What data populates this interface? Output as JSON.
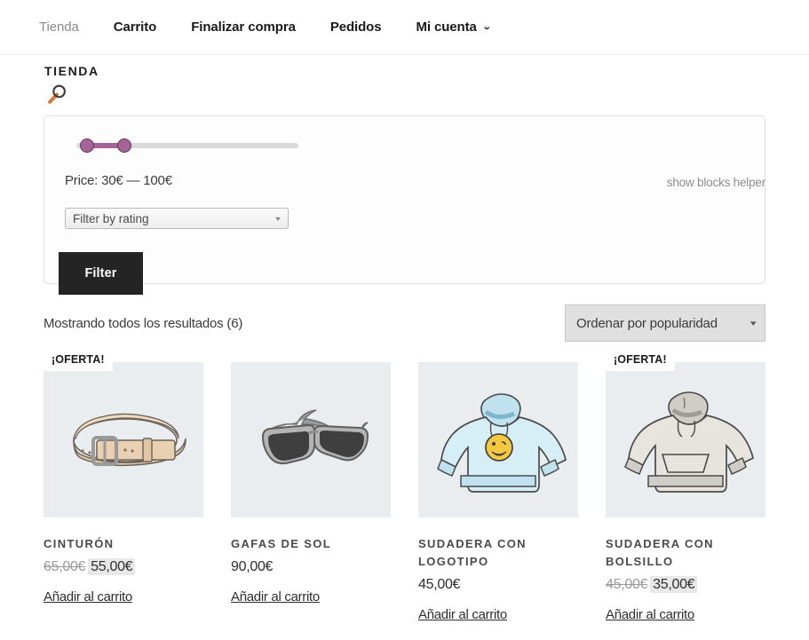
{
  "nav": {
    "items": [
      {
        "label": "Tienda",
        "muted": true,
        "caret": false
      },
      {
        "label": "Carrito",
        "muted": false,
        "caret": false
      },
      {
        "label": "Finalizar compra",
        "muted": false,
        "caret": false
      },
      {
        "label": "Pedidos",
        "muted": false,
        "caret": false
      },
      {
        "label": "Mi cuenta",
        "muted": false,
        "caret": true
      }
    ],
    "caret_glyph": "⌄"
  },
  "page": {
    "title": "TIENDA",
    "search_icon": "magnifier-icon",
    "blocks_helper": "show blocks helper"
  },
  "filter": {
    "price_label": "Price: 30€ — 100€",
    "price_min": "30€",
    "price_max": "100€",
    "slider_accent": "#a46497",
    "slider_track": "#dadada",
    "rating_placeholder": "Filter by rating",
    "caret_glyph": "▾",
    "button_label": "Filter",
    "button_color": "#242424"
  },
  "results": {
    "count_text": "Mostrando todos los resultados (6)",
    "sort_value": "Ordenar por popularidad",
    "caret_glyph": "▾"
  },
  "products": [
    {
      "name": "CINTURÓN",
      "on_sale": true,
      "sale_badge": "¡OFERTA!",
      "old_price": "65,00€",
      "price": "55,00€",
      "add_to_cart": "Añadir al carrito",
      "image": "belt-image"
    },
    {
      "name": "GAFAS DE SOL",
      "on_sale": false,
      "sale_badge": "",
      "old_price": "",
      "price": "90,00€",
      "add_to_cart": "Añadir al carrito",
      "image": "sunglasses-image"
    },
    {
      "name": "SUDADERA CON LOGOTIPO",
      "on_sale": false,
      "sale_badge": "",
      "old_price": "",
      "price": "45,00€",
      "add_to_cart": "Añadir al carrito",
      "image": "blue-hoodie-image"
    },
    {
      "name": "SUDADERA CON BOLSILLO",
      "on_sale": true,
      "sale_badge": "¡OFERTA!",
      "old_price": "45,00€",
      "price": "35,00€",
      "add_to_cart": "Añadir al carrito",
      "image": "gray-hoodie-image"
    }
  ]
}
